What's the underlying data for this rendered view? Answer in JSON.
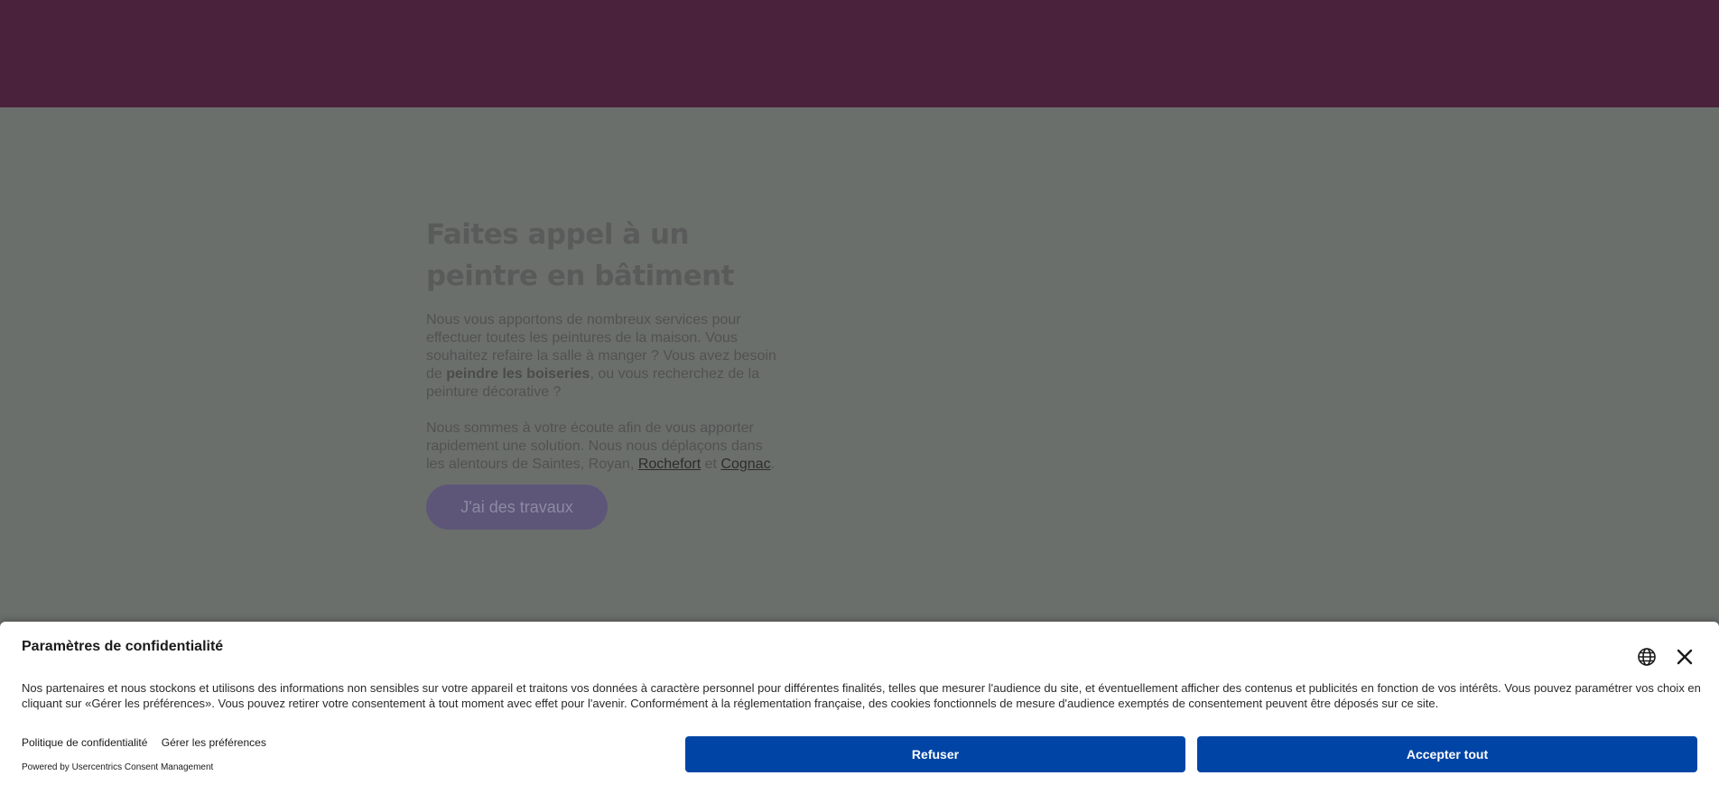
{
  "hero": {
    "title": "Faites appel à un peintre en bâtiment",
    "para1_part1": "Nous vous apportons de nombreux services pour effectuer toutes les peintures de la maison. Vous souhaitez refaire la salle à manger ? Vous avez besoin de ",
    "para1_bold": "peindre les boiseries",
    "para1_part2": ", ou vous recherchez de la peinture décorative ?",
    "para2_part1": "Nous sommes à votre écoute afin de vous apporter rapidement une solution. Nous nous déplaçons dans les alentours de Saintes, Royan, ",
    "link_rochefort": "Rochefort",
    "para2_et": " et ",
    "link_cognac": "Cognac",
    "para2_end": ".",
    "cta_label": "J'ai des travaux"
  },
  "consent": {
    "title": "Paramètres de confidentialité",
    "text": "Nos partenaires et nous stockons et utilisons des informations non sensibles sur votre appareil et traitons vos données à caractère personnel pour différentes finalités, telles que mesurer l'audience du site, et éventuellement afficher des contenus et publicités en fonction de vos intérêts. Vous pouvez paramétrer vos choix en cliquant sur «Gérer les préférences». Vous pouvez retirer votre consentement à tout moment avec effet pour l'avenir. Conformément à la réglementation française, des cookies fonctionnels de mesure d'audience exemptés de consentement peuvent être déposés sur ce site.",
    "privacy_link": "Politique de confidentialité",
    "manage_link": "Gérer les préférences",
    "powered_by": "Powered by Usercentrics Consent Management",
    "refuse_label": "Refuser",
    "accept_label": "Accepter tout",
    "icons": {
      "language": "globe-icon",
      "close": "close-icon"
    },
    "button_color": "#0045a5"
  },
  "colors": {
    "header_bg": "#4b223b",
    "hero_bg_dimmed": "#6b6f6c",
    "cta_bg": "#5d5678"
  }
}
